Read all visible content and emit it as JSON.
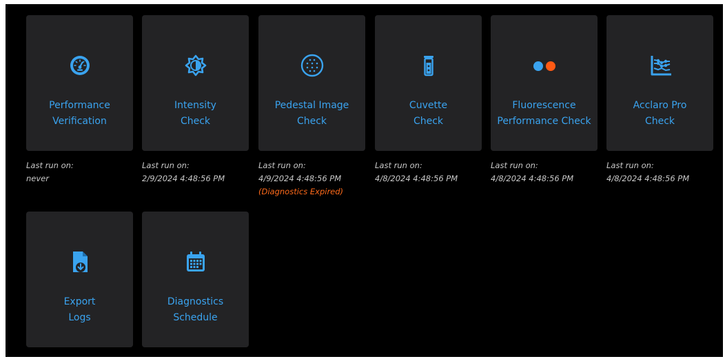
{
  "colors": {
    "background": "#000000",
    "tile": "#232325",
    "accent": "#3aa3ef",
    "warning": "#ff6a1a",
    "meta_text": "#c8c8c8"
  },
  "tiles": [
    {
      "label": "Performance\nVerification",
      "icon": "gauge-icon",
      "last_run_label": "Last run on:",
      "last_run_value": "never",
      "status": ""
    },
    {
      "label": "Intensity\nCheck",
      "icon": "brightness-icon",
      "last_run_label": "Last run on:",
      "last_run_value": "2/9/2024 4:48:56 PM",
      "status": ""
    },
    {
      "label": "Pedestal Image\nCheck",
      "icon": "pedestal-dots-icon",
      "last_run_label": "Last run on:",
      "last_run_value": "4/9/2024 4:48:56 PM",
      "status": "(Diagnostics Expired)"
    },
    {
      "label": "Cuvette\nCheck",
      "icon": "cuvette-icon",
      "last_run_label": "Last run on:",
      "last_run_value": "4/8/2024 4:48:56 PM",
      "status": ""
    },
    {
      "label": "Fluorescence\nPerformance Check",
      "icon": "fluorescence-dots-icon",
      "last_run_label": "Last run on:",
      "last_run_value": "4/8/2024 4:48:56 PM",
      "status": ""
    },
    {
      "label": "Acclaro Pro\nCheck",
      "icon": "line-chart-icon",
      "last_run_label": "Last run on:",
      "last_run_value": "4/8/2024 4:48:56 PM",
      "status": ""
    },
    {
      "label": "Export\nLogs",
      "icon": "export-file-icon"
    },
    {
      "label": "Diagnostics\nSchedule",
      "icon": "calendar-icon"
    }
  ]
}
